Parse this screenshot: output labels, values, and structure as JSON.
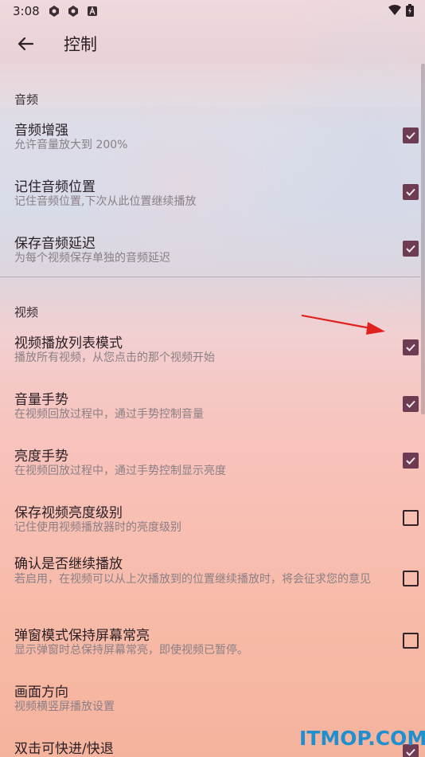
{
  "status_bar": {
    "time": "3:08",
    "icons": [
      "app-icon",
      "app-icon",
      "a-icon"
    ],
    "right_icons": [
      "wifi-icon",
      "battery-icon"
    ]
  },
  "app_bar": {
    "back_icon": "back-arrow-icon",
    "title": "控制"
  },
  "sections": [
    {
      "header": "音频",
      "items": [
        {
          "title": "音频增强",
          "subtitle": "允许音量放大到 200%",
          "checked": true
        },
        {
          "title": "记住音频位置",
          "subtitle": "记住音频位置,下次从此位置继续播放",
          "checked": true
        },
        {
          "title": "保存音频延迟",
          "subtitle": "为每个视频保存单独的音频延迟",
          "checked": true
        }
      ]
    },
    {
      "header": "视频",
      "items": [
        {
          "title": "视频播放列表模式",
          "subtitle": "播放所有视频，从您点击的那个视频开始",
          "checked": true
        },
        {
          "title": "音量手势",
          "subtitle": "在视频回放过程中，通过手势控制音量",
          "checked": true
        },
        {
          "title": "亮度手势",
          "subtitle": "在视频回放过程中，通过手势控制显示亮度",
          "checked": true
        },
        {
          "title": "保存视频亮度级别",
          "subtitle": "记住使用视频播放器时的亮度级别",
          "checked": false
        },
        {
          "title": "确认是否继续播放",
          "subtitle": "若启用，在视频可以从上次播放到的位置继续播放时，将会征求您的意见",
          "checked": false
        },
        {
          "title": "弹窗模式保持屏幕常亮",
          "subtitle": "显示弹窗时总保持屏幕常亮，即使视频已暂停。",
          "checked": false
        },
        {
          "title": "画面方向",
          "subtitle": "视频横竖屏播放设置"
        },
        {
          "title": "双击可快进/快退",
          "checked": true
        }
      ]
    }
  ],
  "watermark": "ITMOP.COM",
  "colors": {
    "checkbox_accent": "#6d3c53",
    "annotation_arrow": "#e0221e",
    "watermark": "#1f8fd0"
  }
}
